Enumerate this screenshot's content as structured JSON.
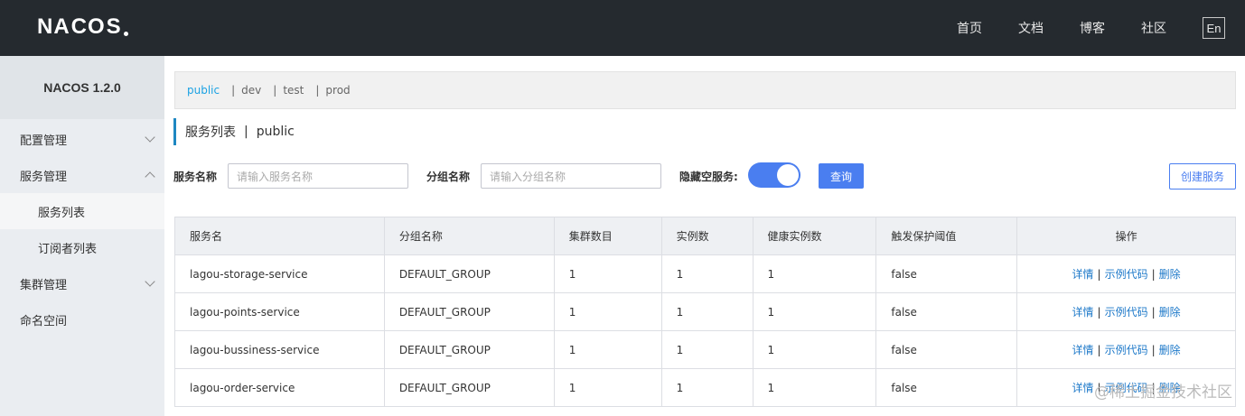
{
  "header": {
    "logo_text_pre": "NA",
    "logo_text_co": "CO",
    "logo_text_post": "S",
    "nav": [
      "首页",
      "文档",
      "博客",
      "社区"
    ],
    "lang": "En"
  },
  "sidebar": {
    "title": "NACOS 1.2.0",
    "items": [
      {
        "label": "配置管理"
      },
      {
        "label": "服务管理"
      },
      {
        "label": "服务列表"
      },
      {
        "label": "订阅者列表"
      },
      {
        "label": "集群管理"
      },
      {
        "label": "命名空间"
      }
    ]
  },
  "namespaces": [
    "public",
    "dev",
    "test",
    "prod"
  ],
  "page": {
    "title": "服务列表",
    "namespace": "public"
  },
  "filters": {
    "service_label": "服务名称",
    "service_placeholder": "请输入服务名称",
    "group_label": "分组名称",
    "group_placeholder": "请输入分组名称",
    "hide_empty_label": "隐藏空服务:",
    "hide_empty_on": true,
    "query_button": "查询",
    "create_button": "创建服务"
  },
  "table": {
    "columns": [
      "服务名",
      "分组名称",
      "集群数目",
      "实例数",
      "健康实例数",
      "触发保护阈值",
      "操作"
    ],
    "rows": [
      [
        "lagou-storage-service",
        "DEFAULT_GROUP",
        "1",
        "1",
        "1",
        "false"
      ],
      [
        "lagou-points-service",
        "DEFAULT_GROUP",
        "1",
        "1",
        "1",
        "false"
      ],
      [
        "lagou-bussiness-service",
        "DEFAULT_GROUP",
        "1",
        "1",
        "1",
        "false"
      ],
      [
        "lagou-order-service",
        "DEFAULT_GROUP",
        "1",
        "1",
        "1",
        "false"
      ]
    ],
    "actions": [
      "详情",
      "示例代码",
      "删除"
    ]
  },
  "watermark": "@稀土掘金技术社区",
  "colors": {
    "header_bg": "#252a2f",
    "accent": "#4a7ef0",
    "link": "#1e79c9",
    "namespace_active": "#1ba2e3"
  }
}
